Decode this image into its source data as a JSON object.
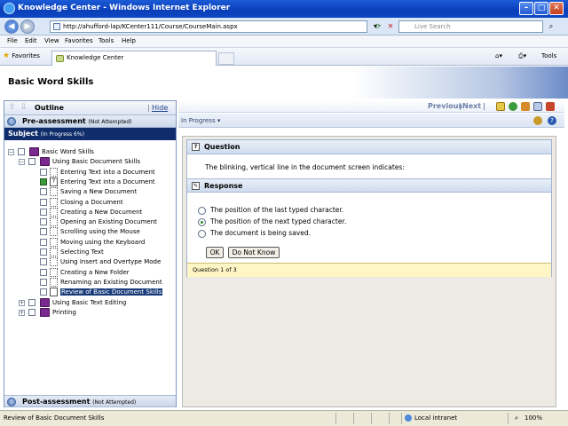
{
  "window": {
    "title": "Knowledge Center - Windows Internet Explorer"
  },
  "address": {
    "url": "http://ahufford-lap/KCenter111/Course/CourseMain.aspx",
    "search_placeholder": "Live Search"
  },
  "menu": [
    "File",
    "Edit",
    "View",
    "Favorites",
    "Tools",
    "Help"
  ],
  "favorites": {
    "label": "Favorites",
    "tab": "Knowledge Center",
    "tools": "Tools"
  },
  "page": {
    "title": "Basic Word Skills"
  },
  "outline": {
    "title": "Outline",
    "hide": "Hide",
    "pre_assessment": {
      "label": "Pre-assessment",
      "status": "(Not Attempted)"
    },
    "subject": {
      "label": "Subject",
      "status": "(In Progress 6%)"
    },
    "post_assessment": {
      "label": "Post-assessment",
      "status": "(Not Attempted)"
    },
    "tree": [
      {
        "label": "Basic Word Skills",
        "level": 0,
        "type": "book"
      },
      {
        "label": "Using Basic Document Skills",
        "level": 1,
        "type": "book"
      },
      {
        "label": "Entering Text into a Document",
        "level": 2,
        "type": "page"
      },
      {
        "label": "Entering Text into a Document",
        "level": 2,
        "type": "quiz"
      },
      {
        "label": "Saving a New Document",
        "level": 2,
        "type": "page"
      },
      {
        "label": "Closing a Document",
        "level": 2,
        "type": "page"
      },
      {
        "label": "Creating a New Document",
        "level": 2,
        "type": "page"
      },
      {
        "label": "Opening an Existing Document",
        "level": 2,
        "type": "page"
      },
      {
        "label": "Scrolling using the Mouse",
        "level": 2,
        "type": "page"
      },
      {
        "label": "Moving using the Keyboard",
        "level": 2,
        "type": "page"
      },
      {
        "label": "Selecting Text",
        "level": 2,
        "type": "page"
      },
      {
        "label": "Using Insert and Overtype Mode",
        "level": 2,
        "type": "page"
      },
      {
        "label": "Creating a New Folder",
        "level": 2,
        "type": "page"
      },
      {
        "label": "Renaming an Existing Document",
        "level": 2,
        "type": "page"
      },
      {
        "label": "Review of Basic Document Skills",
        "level": 2,
        "type": "review"
      },
      {
        "label": "Using Basic Text Editing",
        "level": 1,
        "type": "book"
      },
      {
        "label": "Printing",
        "level": 1,
        "type": "book"
      }
    ]
  },
  "content": {
    "previous": "Previous",
    "next": "Next",
    "progress_state": "In Progress",
    "question_header": "Question",
    "question_text": "The blinking, vertical line in the document screen indicates:",
    "response_header": "Response",
    "options": [
      "The position of the last typed character.",
      "The position of the next typed character.",
      "The document is being saved."
    ],
    "selected_option": 1,
    "ok_label": "OK",
    "dont_know_label": "Do Not Know",
    "question_count": "Question 1 of 3"
  },
  "status": {
    "text": "Review of Basic Document Skills",
    "zone": "Local intranet",
    "zoom": "100%"
  }
}
